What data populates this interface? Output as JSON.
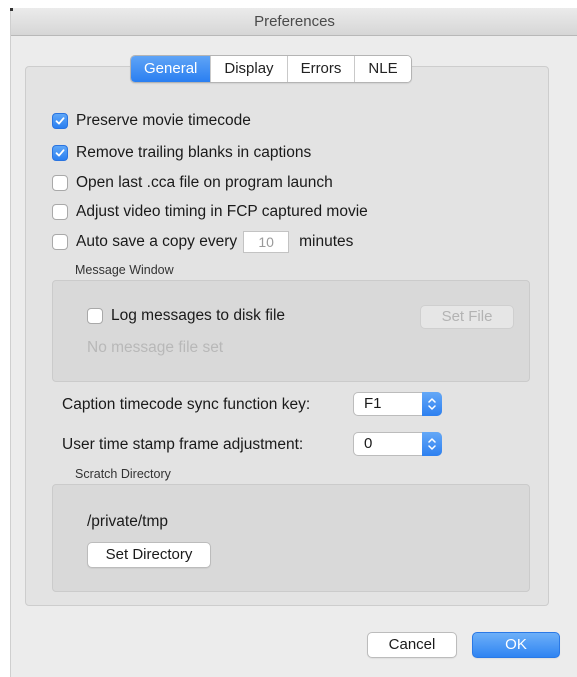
{
  "window": {
    "title": "Preferences"
  },
  "tabs": [
    {
      "label": "General",
      "active": true
    },
    {
      "label": "Display",
      "active": false
    },
    {
      "label": "Errors",
      "active": false
    },
    {
      "label": "NLE",
      "active": false
    }
  ],
  "options": {
    "preserve_timecode": {
      "label": "Preserve movie timecode",
      "checked": true
    },
    "remove_trailing": {
      "label": "Remove trailing blanks in captions",
      "checked": true
    },
    "open_last": {
      "label": "Open last .cca file on program launch",
      "checked": false
    },
    "adjust_video": {
      "label": "Adjust video timing in FCP captured movie",
      "checked": false
    },
    "auto_save": {
      "label": "Auto save a copy every",
      "checked": false,
      "value": "10",
      "suffix": "minutes"
    }
  },
  "message_window": {
    "title": "Message Window",
    "log_label": "Log messages to disk file",
    "log_checked": false,
    "set_file_label": "Set File",
    "status": "No message file set"
  },
  "sync_key": {
    "label": "Caption timecode sync function key:",
    "value": "F1"
  },
  "frame_adjust": {
    "label": "User time stamp frame adjustment:",
    "value": "0"
  },
  "scratch": {
    "title": "Scratch Directory",
    "path": "/private/tmp",
    "set_dir_label": "Set Directory"
  },
  "footer": {
    "cancel_label": "Cancel",
    "ok_label": "OK"
  },
  "colors": {
    "accent": "#2a7ff1",
    "background": "#ececec",
    "disabled_text": "#b3b3b3"
  }
}
